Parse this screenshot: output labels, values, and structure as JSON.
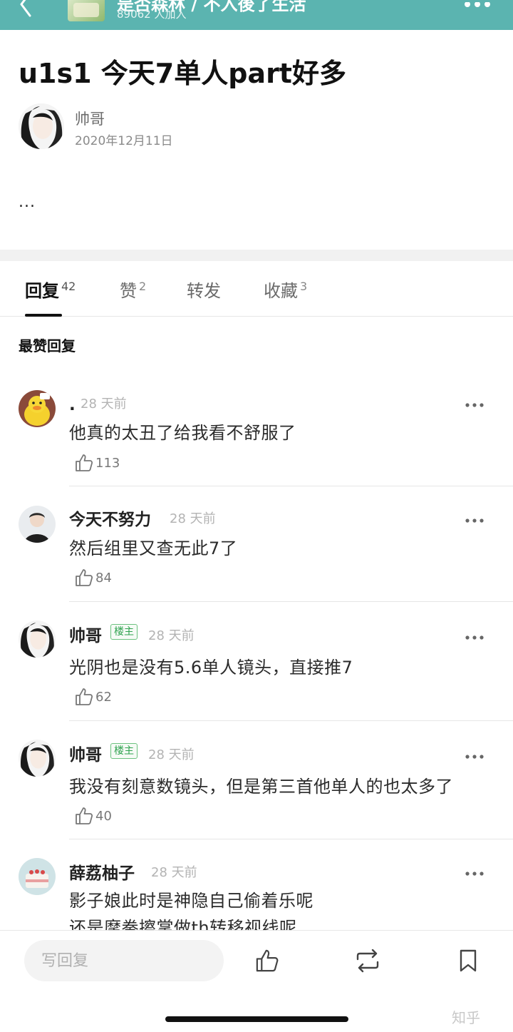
{
  "colors": {
    "header_bg": "#5bb4b0",
    "badge_green": "#2ea24e",
    "accent_dark": "#111111"
  },
  "header": {
    "group_name": "是否森林 / 不入後了生活",
    "members": "89062 人加入",
    "back_icon": "chevron-left-icon",
    "more_icon": "more-dots-icon"
  },
  "post": {
    "title": "u1s1 今天7单人part好多",
    "author": "帅哥",
    "date": "2020年12月11日",
    "body": "..."
  },
  "tabs": [
    {
      "label": "回复",
      "count": "42",
      "active": true
    },
    {
      "label": "赞",
      "count": "2",
      "active": false
    },
    {
      "label": "转发",
      "count": "",
      "active": false
    },
    {
      "label": "收藏",
      "count": "3",
      "active": false
    }
  ],
  "section_title": "最赞回复",
  "comments": [
    {
      "name": ".",
      "badge": "",
      "time": "28 天前",
      "lines": [
        "他真的太丑了给我看不舒服了"
      ],
      "likes": "113"
    },
    {
      "name": "今天不努力",
      "badge": "",
      "time": "28 天前",
      "lines": [
        "然后组里又查无此7了"
      ],
      "likes": "84"
    },
    {
      "name": "帅哥",
      "badge": "楼主",
      "time": "28 天前",
      "lines": [
        "光阴也是没有5.6单人镜头，直接推7"
      ],
      "likes": "62"
    },
    {
      "name": "帅哥",
      "badge": "楼主",
      "time": "28 天前",
      "lines": [
        "我没有刻意数镜头，但是第三首他单人的也太多了"
      ],
      "likes": "40"
    },
    {
      "name": "薛荔柚子",
      "badge": "",
      "time": "28 天前",
      "lines": [
        "影子娘此时是神隐自己偷着乐呢",
        "还是摩拳擦掌做th转移视线呢"
      ],
      "likes": ""
    }
  ],
  "bottom_bar": {
    "reply_placeholder": "写回复",
    "like_icon": "thumbs-up-icon",
    "repost_icon": "repost-icon",
    "bookmark_icon": "bookmark-icon"
  },
  "watermark": "知乎"
}
